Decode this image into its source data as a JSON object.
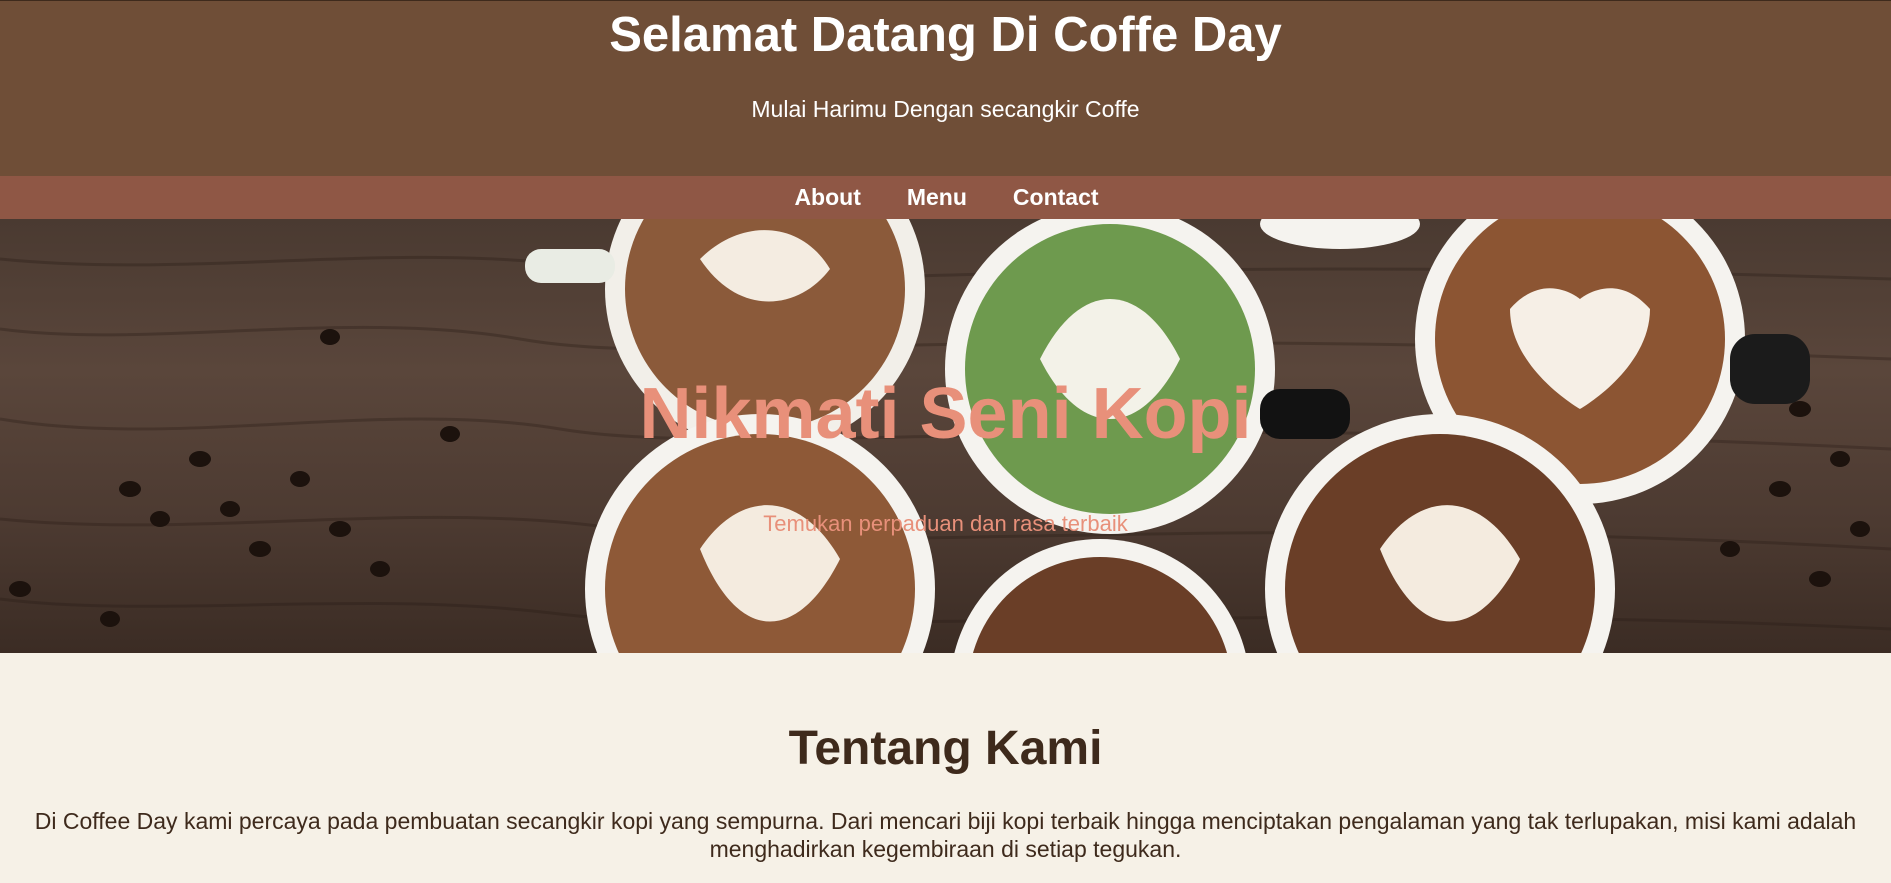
{
  "header": {
    "title": "Selamat Datang Di Coffe Day",
    "tagline": "Mulai Harimu Dengan secangkir Coffe"
  },
  "nav": {
    "items": [
      {
        "label": "About"
      },
      {
        "label": "Menu"
      },
      {
        "label": "Contact"
      }
    ]
  },
  "hero": {
    "title": "Nikmati Seni Kopi",
    "subtitle": "Temukan perpaduan dan rasa terbaik"
  },
  "about": {
    "title": "Tentang Kami",
    "text": "Di Coffee Day kami percaya pada pembuatan secangkir kopi yang sempurna. Dari mencari biji kopi terbaik hingga menciptakan pengalaman yang tak terlupakan, misi kami adalah menghadirkan kegembiraan di setiap tegukan."
  },
  "colors": {
    "header_bg": "#6f4e37",
    "nav_bg": "#8f5745",
    "hero_text": "#e8907a",
    "page_bg": "#f6f1e7",
    "heading_text": "#3e2a1c"
  }
}
